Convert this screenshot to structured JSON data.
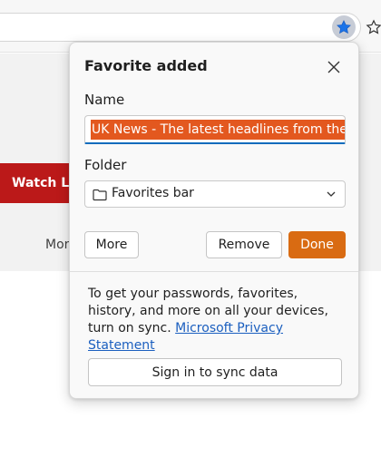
{
  "toolbar": {
    "favorite_button_icon": "star-filled-icon",
    "favorites_button_icon": "star-outline-icon",
    "accent": "#1a73e8"
  },
  "page": {
    "watch_live_label": "Watch Live",
    "more_label": "More",
    "brand_red": "#bb1919"
  },
  "popup": {
    "title": "Favorite added",
    "close_icon": "close-icon",
    "name_label": "Name",
    "name_value": "UK News - The latest headlines from the BBC",
    "folder_label": "Folder",
    "folder_value": "Favorites bar",
    "folder_icon": "folder-icon",
    "more_button": "More",
    "remove_button": "Remove",
    "done_button": "Done",
    "done_color": "#d96b12",
    "sync_text": "To get your passwords, favorites, history, and more on all your devices, turn on sync. ",
    "privacy_link": "Microsoft Privacy Statement",
    "sync_button": "Sign in to sync data"
  }
}
